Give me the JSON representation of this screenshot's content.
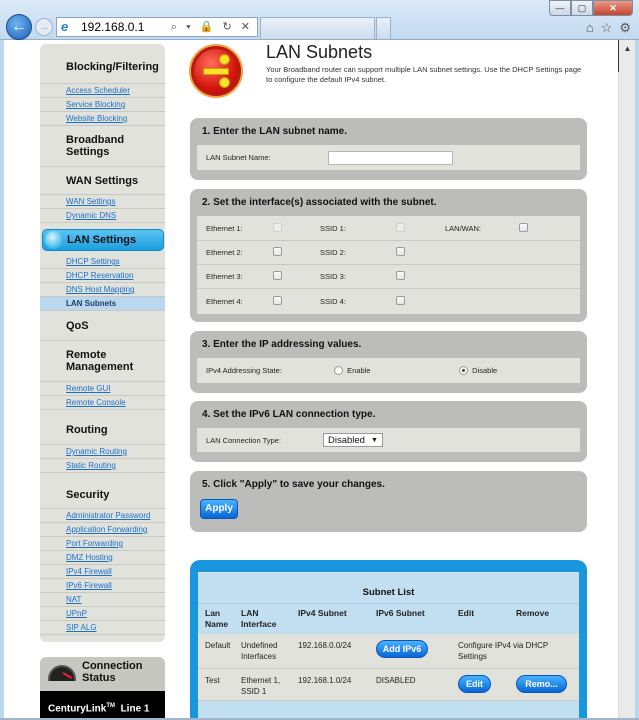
{
  "browser": {
    "url": "192.168.0.1",
    "address_tools": "⌕ ▾ 🔒 ↻ ✕",
    "window_buttons": {
      "minimize": "—",
      "maximize": "▢",
      "close": "✕"
    },
    "icons": {
      "back": "back-arrow-icon",
      "forward": "forward-arrow-icon",
      "home": "home-icon",
      "favorites": "star-icon",
      "tools": "gear-icon"
    }
  },
  "sidebar": {
    "sections": [
      {
        "title": "Blocking/Filtering",
        "links": [
          "Access Scheduler",
          "Service Blocking",
          "Website Blocking"
        ]
      },
      {
        "title": "Broadband Settings",
        "links": []
      },
      {
        "title": "WAN Settings",
        "links": [
          "WAN Settings",
          "Dynamic DNS"
        ]
      },
      {
        "title": "LAN Settings",
        "links": [
          "DHCP Settings",
          "DHCP Reservation",
          "DNS Host Mapping",
          "LAN Subnets"
        ],
        "active_link": "LAN Subnets"
      },
      {
        "title": "QoS",
        "links": []
      },
      {
        "title": "Remote Management",
        "links": [
          "Remote GUI",
          "Remote Console"
        ]
      },
      {
        "title": "Routing",
        "links": [
          "Dynamic Routing",
          "Static Routing"
        ]
      },
      {
        "title": "Security",
        "links": [
          "Administrator Password",
          "Application Forwarding",
          "Port Forwarding",
          "DMZ Hosting",
          "IPv4 Firewall",
          "IPv6 Firewall",
          "NAT",
          "UPnP",
          "SIP ALG"
        ]
      }
    ],
    "connection_status": {
      "title_line1": "Connection",
      "title_line2": "Status",
      "brand": "CenturyLink",
      "tm": "TM",
      "line": "Line 1"
    }
  },
  "header": {
    "title": "LAN Subnets",
    "description": "Your Broadband router can support multiple LAN subnet settings. Use the DHCP Settings page to configure the default IPv4 subnet."
  },
  "step1": {
    "title": "1. Enter the LAN subnet name.",
    "label": "LAN Subnet Name:",
    "value": ""
  },
  "step2": {
    "title": "2. Set the interface(s) associated with the subnet.",
    "rows": [
      {
        "eth": "Ethernet 1:",
        "ssid": "SSID 1:",
        "extra": "LAN/WAN:"
      },
      {
        "eth": "Ethernet 2:",
        "ssid": "SSID 2:"
      },
      {
        "eth": "Ethernet 3:",
        "ssid": "SSID 3:"
      },
      {
        "eth": "Ethernet 4:",
        "ssid": "SSID 4:"
      }
    ]
  },
  "step3": {
    "title": "3. Enter the IP addressing values.",
    "label": "IPv4 Addressing State:",
    "options": [
      "Enable",
      "Disable"
    ],
    "selected": "Disable"
  },
  "step4": {
    "title": "4. Set the IPv6 LAN connection type.",
    "label": "LAN Connection Type:",
    "selected": "Disabled"
  },
  "step5": {
    "title": "5. Click \"Apply\" to save your changes.",
    "apply_label": "Apply"
  },
  "subnet_list": {
    "caption": "Subnet List",
    "headers": [
      "Lan Name",
      "LAN Interface",
      "IPv4 Subnet",
      "IPv6 Subnet",
      "Edit",
      "Remove"
    ],
    "rows": [
      {
        "name": "Default",
        "interface": "Undefined Interfaces",
        "ipv4": "192.168.0.0/24",
        "ipv6_button": "Add IPv6",
        "edit_text": "Configure IPv4 via DHCP Settings"
      },
      {
        "name": "Test",
        "interface": "Ethernet 1, SSID 1",
        "ipv4": "192.168.1.0/24",
        "ipv6": "DISABLED",
        "edit_button": "Edit",
        "remove_button": "Remo..."
      }
    ]
  }
}
